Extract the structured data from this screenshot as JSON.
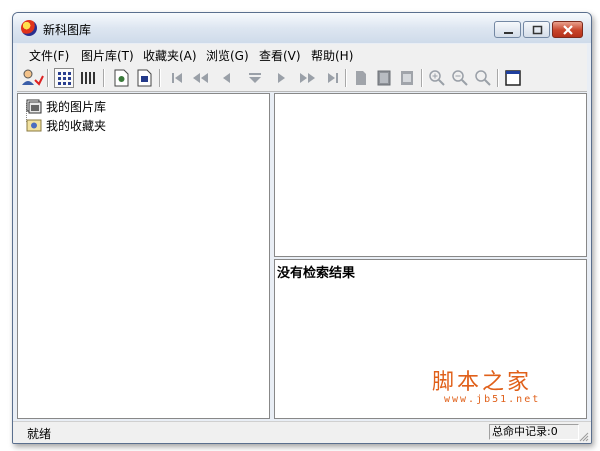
{
  "window": {
    "title": "新科图库"
  },
  "menu": [
    "文件(F)",
    "图片库(T)",
    "收藏夹(A)",
    "浏览(G)",
    "查看(V)",
    "帮助(H)"
  ],
  "toolbar": {
    "icons": [
      "user-search-icon",
      "large-icons-view-icon",
      "list-view-icon",
      "new-file-icon",
      "save-file-icon",
      "first-icon",
      "rewind-icon",
      "prev-icon",
      "eject-icon",
      "next-icon",
      "fast-forward-icon",
      "last-icon",
      "page-icon",
      "page-dark-icon",
      "page-frame-icon",
      "zoom-in-icon",
      "zoom-out-icon",
      "zoom-icon",
      "window-icon"
    ]
  },
  "tree": {
    "items": [
      {
        "label": "我的图片库",
        "icon": "library-icon"
      },
      {
        "label": "我的收藏夹",
        "icon": "favorites-icon"
      }
    ]
  },
  "results": {
    "empty_text": "没有检索结果"
  },
  "status": {
    "left": "就绪",
    "right": "总命中记录:0"
  },
  "watermark": {
    "logo_text": "脚本之家",
    "url": "www.jb51.net"
  },
  "colors": {
    "titlebar": "#dde6f1",
    "close_button": "#c8452b",
    "watermark": "#e0601a"
  }
}
